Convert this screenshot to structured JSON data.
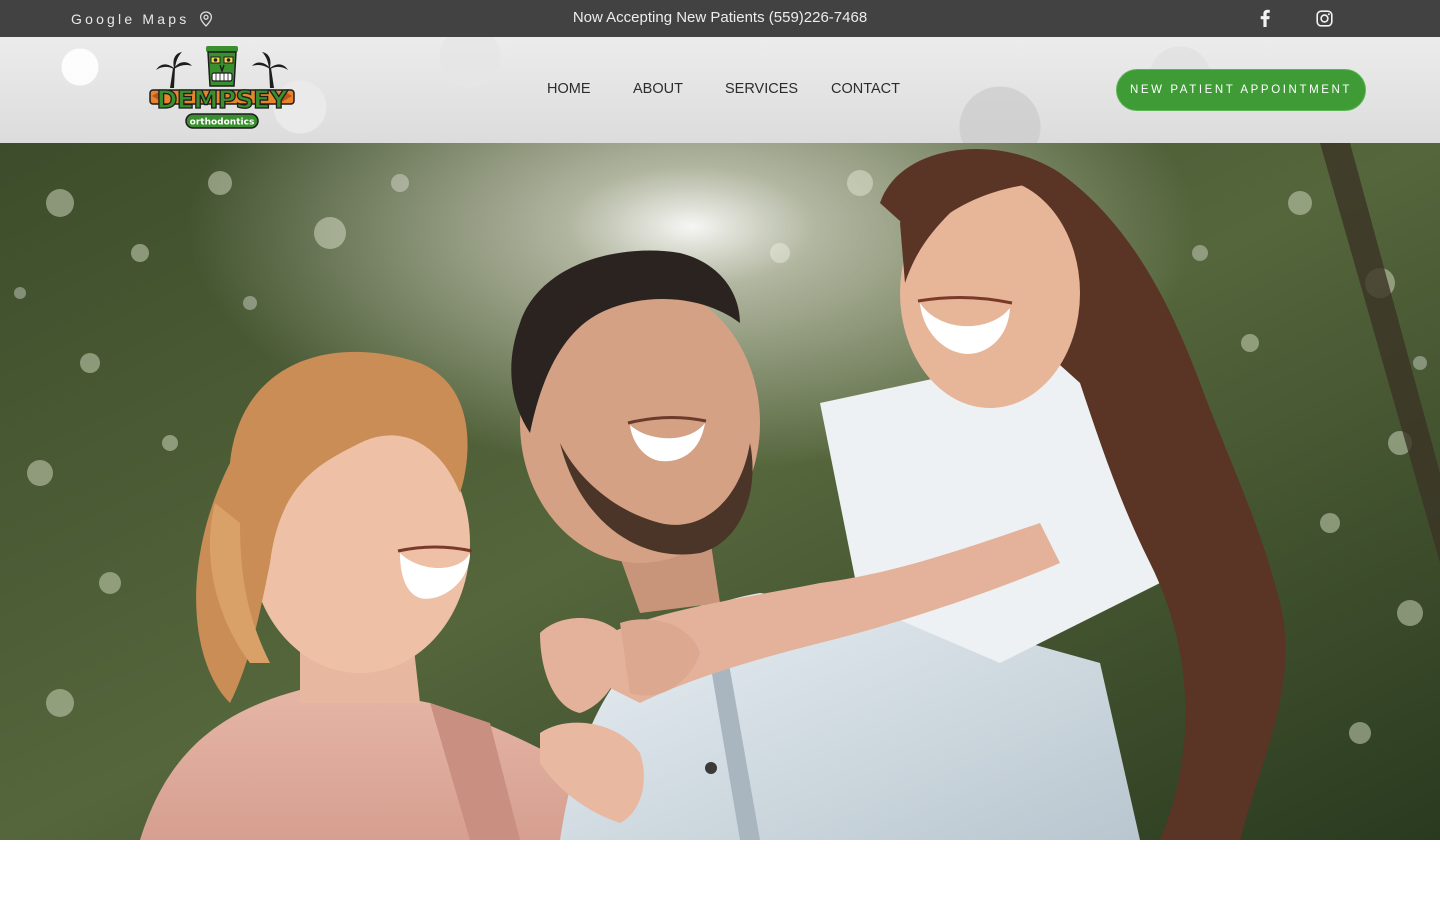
{
  "topbar": {
    "maps_label": "Google Maps",
    "maps_icon": "map-pin-icon",
    "announcement": "Now Accepting New Patients (559)226-7468",
    "social": [
      {
        "name": "facebook-icon"
      },
      {
        "name": "instagram-icon"
      }
    ]
  },
  "header": {
    "logo": {
      "title": "DEMPSEY",
      "subtitle": "orthodontics"
    },
    "nav": {
      "home": "HOME",
      "about": "ABOUT",
      "services": "SERVICES",
      "contact": "CONTACT"
    },
    "cta_label": "NEW PATIENT APPOINTMENT"
  },
  "colors": {
    "topbar_bg": "#424242",
    "cta_green": "#3e9b36",
    "logo_green": "#3a8f2e",
    "logo_orange": "#e8852b"
  }
}
